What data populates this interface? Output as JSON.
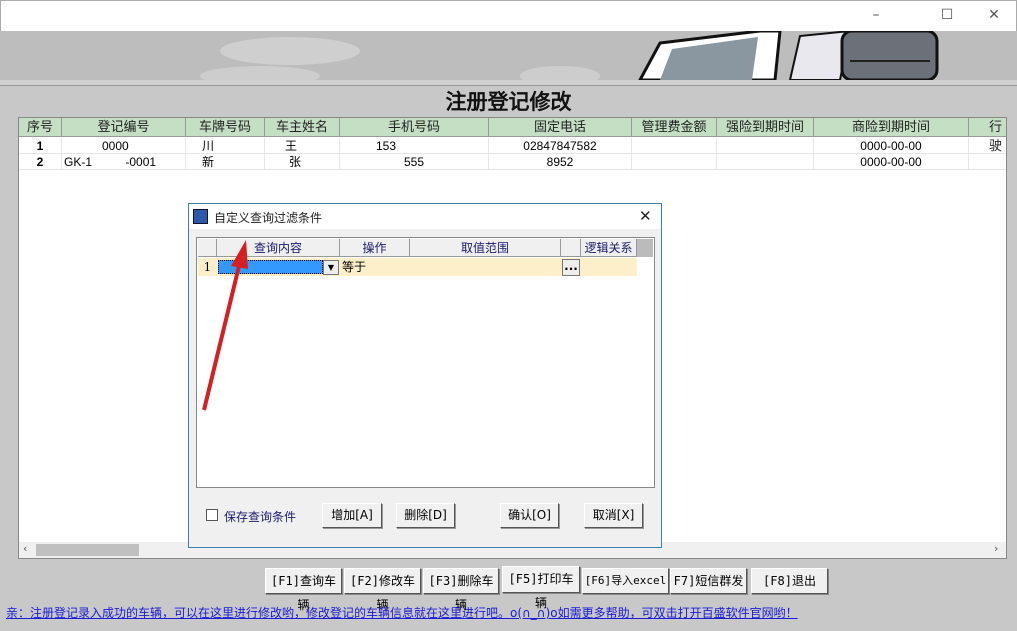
{
  "window": {
    "minimize": "–",
    "maximize": "☐",
    "close": "✕"
  },
  "page_title": "注册登记修改",
  "table": {
    "columns": [
      "序号",
      "登记编号",
      "车牌号码",
      "车主姓名",
      "手机号码",
      "固定电话",
      "管理费金额",
      "强险到期时间",
      "商险到期时间",
      "行驶"
    ],
    "rows": [
      [
        "1",
        "0000",
        "川",
        "王",
        "153",
        "02847847582",
        "",
        "",
        "0000-00-00",
        ""
      ],
      [
        "2",
        "GK-1          -0001",
        "新",
        "张",
        "555",
        "8952",
        "",
        "",
        "0000-00-00",
        ""
      ]
    ]
  },
  "dialog": {
    "title": "自定义查询过滤条件",
    "close": "✕",
    "columns": [
      "查询内容",
      "操作",
      "取值范围",
      "逻辑关系"
    ],
    "rows": [
      {
        "num": "1",
        "content": "",
        "op": "等于",
        "range": "",
        "btn": "...",
        "logic": ""
      }
    ],
    "save_label": "保存查询条件",
    "add": "增加[A]",
    "delete": "删除[D]",
    "ok": "确认[O]",
    "cancel": "取消[X]"
  },
  "buttons": [
    "[F1]查询车辆",
    "[F2]修改车辆",
    "[F3]删除车辆",
    "[F5]打印车辆",
    "[F6]导入excel",
    "F7]短信群发",
    "[F8]退出"
  ],
  "status": "亲：注册登记录入成功的车辆，可以在这里进行修改哟，修改登记的车辆信息就在这里进行吧。o(∩_∩)o如需更多帮助，可双击打开百盛软件官网哟！",
  "colors": {
    "header_green": "#c4dfc4",
    "row_yellow": "#fdefc9",
    "link_blue": "#1a1ad8",
    "arrow_red": "#d42020"
  }
}
